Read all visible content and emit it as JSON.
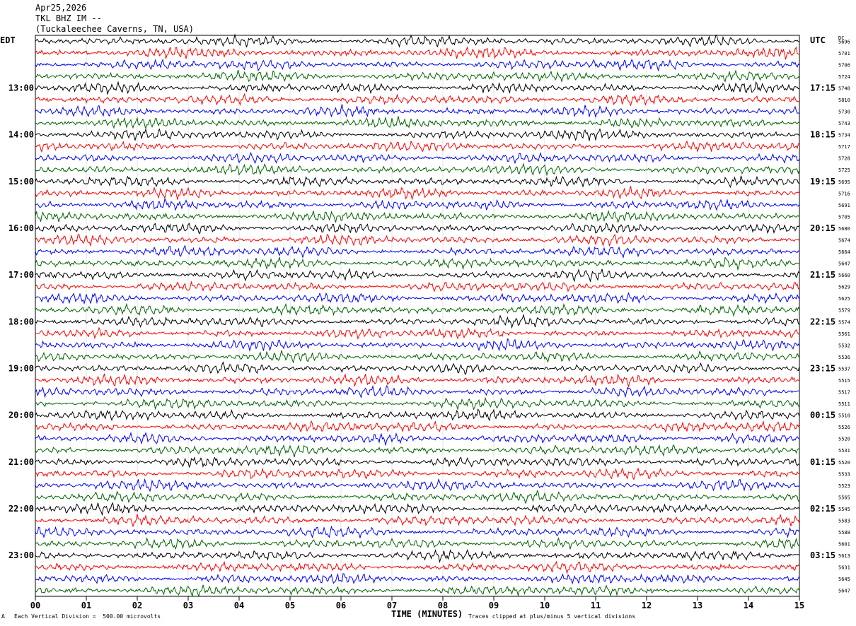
{
  "header": {
    "date": "Apr25,2026",
    "station": "TKL BHZ IM --",
    "location": "(Tuckaleechee Caverns, TN, USA)"
  },
  "left_tz": "EDT",
  "right_tz": "UTC",
  "dc_label": "DC",
  "footer": {
    "scale_note": "Each Vertical Division =  500.00 microvolts",
    "clip_note": "Traces clipped at plus/minus 5 vertical divisions",
    "corner_mark": "A"
  },
  "colors": [
    "#000000",
    "#ff0000",
    "#0000ff",
    "#006400"
  ],
  "chart_data": {
    "type": "line",
    "title": "TKL BHZ IM --",
    "xlabel": "TIME (MINUTES)",
    "xlim": [
      0,
      15
    ],
    "x_ticks": [
      "00",
      "01",
      "02",
      "03",
      "04",
      "05",
      "06",
      "07",
      "08",
      "09",
      "10",
      "11",
      "12",
      "13",
      "14",
      "15"
    ],
    "traces_per_hour": 4,
    "left_hour_labels": [
      "13:00",
      "14:00",
      "15:00",
      "16:00",
      "17:00",
      "18:00",
      "19:00",
      "20:00",
      "21:00",
      "22:00",
      "23:00"
    ],
    "right_hour_labels": [
      "17:15",
      "18:15",
      "19:15",
      "20:15",
      "21:15",
      "22:15",
      "23:15",
      "00:15",
      "01:15",
      "02:15",
      "03:15"
    ],
    "dc_offsets": [
      "5696",
      "5701",
      "5706",
      "5724",
      "5740",
      "5810",
      "5730",
      "5743",
      "5734",
      "5717",
      "5728",
      "5725",
      "5695",
      "5716",
      "5691",
      "5705",
      "5680",
      "5674",
      "5664",
      "5647",
      "5660",
      "5629",
      "5625",
      "5579",
      "5574",
      "5561",
      "5532",
      "5536",
      "5537",
      "5515",
      "5517",
      "5511",
      "5510",
      "5526",
      "5520",
      "5531",
      "5520",
      "5533",
      "5523",
      "5565",
      "5545",
      "5583",
      "5588",
      "5601",
      "5613",
      "5631",
      "5645",
      "5647"
    ]
  }
}
